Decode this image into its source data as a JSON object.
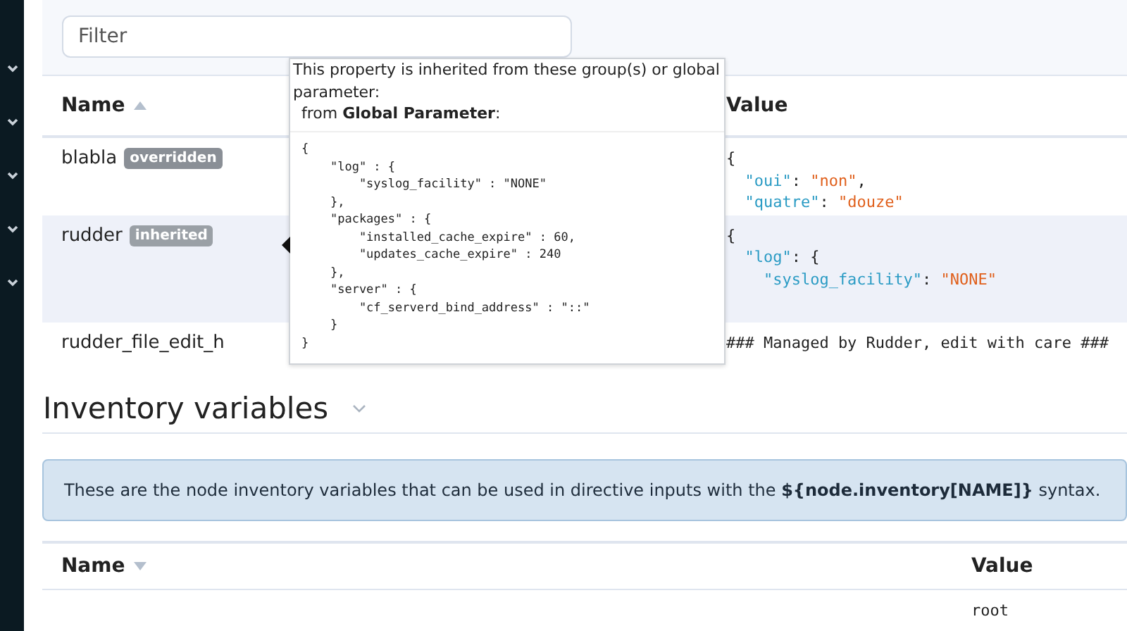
{
  "sidebar": {
    "items": [
      {
        "expanded": false
      },
      {
        "expanded": false
      },
      {
        "expanded": false
      },
      {
        "expanded": false
      },
      {
        "expanded": false
      }
    ]
  },
  "filter": {
    "placeholder": "Filter"
  },
  "properties": {
    "columns": [
      {
        "label": "Name",
        "sort_descending": false
      },
      {
        "label": "Value"
      }
    ],
    "rows": [
      {
        "name": "blabla",
        "badge": "overridden",
        "highlighted": false,
        "value": [
          [
            {
              "t": "{",
              "kind": "punct"
            }
          ],
          [
            {
              "t": "  \"oui\"",
              "kind": "key"
            },
            {
              "t": ": ",
              "kind": "punct"
            },
            {
              "t": "\"non\"",
              "kind": "string"
            },
            {
              "t": ",",
              "kind": "punct"
            }
          ],
          [
            {
              "t": "  \"quatre\"",
              "kind": "key"
            },
            {
              "t": ": ",
              "kind": "punct"
            },
            {
              "t": "\"douze\"",
              "kind": "string"
            }
          ]
        ]
      },
      {
        "name": "rudder",
        "badge": "inherited",
        "highlighted": true,
        "value": [
          [
            {
              "t": "{",
              "kind": "punct"
            }
          ],
          [
            {
              "t": "  \"log\"",
              "kind": "key"
            },
            {
              "t": ": {",
              "kind": "punct"
            }
          ],
          [
            {
              "t": "    \"syslog_facility\"",
              "kind": "key"
            },
            {
              "t": ": ",
              "kind": "punct"
            },
            {
              "t": "\"NONE\"",
              "kind": "string"
            }
          ]
        ]
      },
      {
        "name": "rudder_file_edit_h",
        "highlighted": false,
        "value": [
          [
            {
              "t": "### Managed by Rudder, edit with care ###",
              "kind": "punct"
            }
          ]
        ]
      }
    ]
  },
  "tooltip": {
    "text": "This property is inherited from these group(s) or global parameter:",
    "source": "from **Global Parameter**:",
    "code": "{\n    \"log\" : {\n        \"syslog_facility\" : \"NONE\"\n    },\n    \"packages\" : {\n        \"installed_cache_expire\" : 60,\n        \"updates_cache_expire\" : 240\n    },\n    \"server\" : {\n        \"cf_serverd_bind_address\" : \"::\"\n    }\n}"
  },
  "inventory": {
    "title": "Inventory variables",
    "expanded": false,
    "info": "These are the node inventory variables that can be used in directive inputs with the **${node.inventory[NAME]}** syntax.",
    "columns": [
      {
        "label": "Name",
        "sort_descending": true
      },
      {
        "label": "Value"
      }
    ],
    "rows": [
      {
        "value": "root"
      }
    ]
  }
}
